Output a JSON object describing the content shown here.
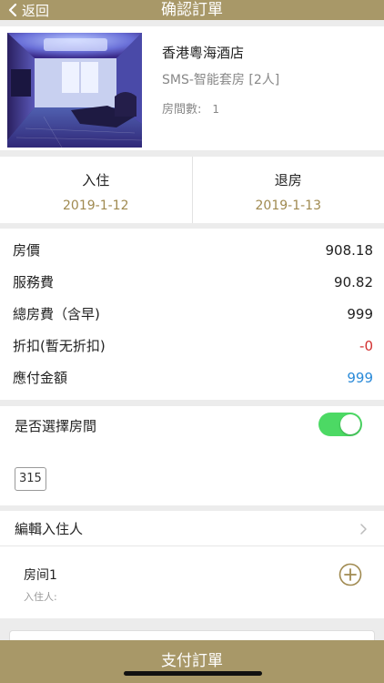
{
  "header": {
    "back_label": "返回",
    "title": "确認訂單"
  },
  "hotel": {
    "name": "香港粵海酒店",
    "room_type": "SMS-智能套房 [2人]",
    "room_count_label": "房間數:",
    "room_count": "1"
  },
  "dates": {
    "checkin_label": "入住",
    "checkin_date": "2019-1-12",
    "checkout_label": "退房",
    "checkout_date": "2019-1-13"
  },
  "prices": [
    {
      "label": "房價",
      "value": "908.18"
    },
    {
      "label": "服務費",
      "value": "90.82"
    },
    {
      "label": "總房費（含早)",
      "value": "999"
    },
    {
      "label": "折扣(暫无折扣)",
      "value": "-0"
    },
    {
      "label": "應付金額",
      "value": "999"
    }
  ],
  "room_select": {
    "label": "是否選擇房間",
    "toggle_on": true,
    "room_number": "315"
  },
  "guest": {
    "edit_label": "編輯入住人",
    "room_label": "房间1",
    "guest_label": "入住人:"
  },
  "pay": {
    "label": "支付訂單"
  },
  "colors": {
    "accent": "#a89868",
    "date": "#a08a50",
    "discount": "#d23030",
    "total": "#2a8ad8",
    "toggle": "#4cd964"
  }
}
